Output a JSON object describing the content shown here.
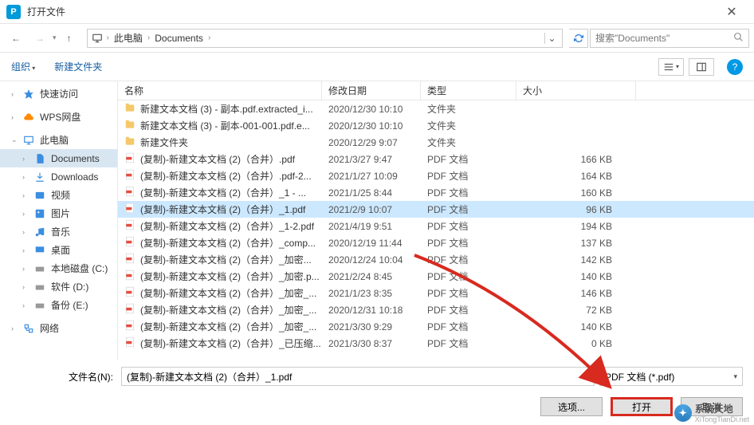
{
  "title": "打开文件",
  "nav": {
    "back": "←",
    "forward": "→",
    "up": "↑"
  },
  "breadcrumb": {
    "items": [
      "此电脑",
      "Documents"
    ],
    "search_placeholder": "搜索\"Documents\""
  },
  "toolbar": {
    "organize": "组织",
    "new_folder": "新建文件夹"
  },
  "sidebar": {
    "items": [
      {
        "label": "快速访问",
        "icon": "star",
        "color": "#3b8ee0",
        "chev": "›"
      },
      {
        "label": "WPS网盘",
        "icon": "cloud",
        "color": "#ff8a00",
        "chev": "›"
      },
      {
        "label": "此电脑",
        "icon": "pc",
        "color": "#3b8ee0",
        "chev": "⌄"
      },
      {
        "label": "Documents",
        "icon": "doc",
        "color": "#3b8ee0",
        "indent": true,
        "selected": true,
        "chev": "›"
      },
      {
        "label": "Downloads",
        "icon": "down",
        "color": "#3b8ee0",
        "indent": true,
        "chev": "›"
      },
      {
        "label": "视频",
        "icon": "video",
        "color": "#3b8ee0",
        "indent": true,
        "chev": "›"
      },
      {
        "label": "图片",
        "icon": "pic",
        "color": "#3b8ee0",
        "indent": true,
        "chev": "›"
      },
      {
        "label": "音乐",
        "icon": "music",
        "color": "#3b8ee0",
        "indent": true,
        "chev": "›"
      },
      {
        "label": "桌面",
        "icon": "desk",
        "color": "#3b8ee0",
        "indent": true,
        "chev": "›"
      },
      {
        "label": "本地磁盘 (C:)",
        "icon": "disk",
        "color": "#888",
        "indent": true,
        "chev": "›"
      },
      {
        "label": "软件 (D:)",
        "icon": "disk",
        "color": "#888",
        "indent": true,
        "chev": "›"
      },
      {
        "label": "备份 (E:)",
        "icon": "disk",
        "color": "#888",
        "indent": true,
        "chev": "›"
      },
      {
        "label": "网络",
        "icon": "net",
        "color": "#3b8ee0",
        "chev": "›"
      }
    ]
  },
  "columns": {
    "name": "名称",
    "date": "修改日期",
    "type": "类型",
    "size": "大小"
  },
  "files": [
    {
      "name": "新建文本文档 (3) - 副本.pdf.extracted_i...",
      "date": "2020/12/30 10:10",
      "type": "文件夹",
      "size": "",
      "kind": "folder"
    },
    {
      "name": "新建文本文档 (3) - 副本-001-001.pdf.e...",
      "date": "2020/12/30 10:10",
      "type": "文件夹",
      "size": "",
      "kind": "folder"
    },
    {
      "name": "新建文件夹",
      "date": "2020/12/29 9:07",
      "type": "文件夹",
      "size": "",
      "kind": "folder"
    },
    {
      "name": "(复制)-新建文本文档 (2)（合并）.pdf",
      "date": "2021/3/27 9:47",
      "type": "PDF 文档",
      "size": "166 KB",
      "kind": "pdf"
    },
    {
      "name": "(复制)-新建文本文档 (2)（合并）.pdf-2...",
      "date": "2021/1/27 10:09",
      "type": "PDF 文档",
      "size": "164 KB",
      "kind": "pdf"
    },
    {
      "name": "(复制)-新建文本文档 (2)（合并）_1 - ...",
      "date": "2021/1/25 8:44",
      "type": "PDF 文档",
      "size": "160 KB",
      "kind": "pdf"
    },
    {
      "name": "(复制)-新建文本文档 (2)（合并）_1.pdf",
      "date": "2021/2/9 10:07",
      "type": "PDF 文档",
      "size": "96 KB",
      "kind": "pdf",
      "selected": true
    },
    {
      "name": "(复制)-新建文本文档 (2)（合并）_1-2.pdf",
      "date": "2021/4/19 9:51",
      "type": "PDF 文档",
      "size": "194 KB",
      "kind": "pdf"
    },
    {
      "name": "(复制)-新建文本文档 (2)（合并）_comp...",
      "date": "2020/12/19 11:44",
      "type": "PDF 文档",
      "size": "137 KB",
      "kind": "pdf"
    },
    {
      "name": "(复制)-新建文本文档 (2)（合并）_加密...",
      "date": "2020/12/24 10:04",
      "type": "PDF 文档",
      "size": "142 KB",
      "kind": "pdf"
    },
    {
      "name": "(复制)-新建文本文档 (2)（合并）_加密.p...",
      "date": "2021/2/24 8:45",
      "type": "PDF 文档",
      "size": "140 KB",
      "kind": "pdf"
    },
    {
      "name": "(复制)-新建文本文档 (2)（合并）_加密_...",
      "date": "2021/1/23 8:35",
      "type": "PDF 文档",
      "size": "146 KB",
      "kind": "pdf"
    },
    {
      "name": "(复制)-新建文本文档 (2)（合并）_加密_...",
      "date": "2020/12/31 10:18",
      "type": "PDF 文档",
      "size": "72 KB",
      "kind": "pdf"
    },
    {
      "name": "(复制)-新建文本文档 (2)（合并）_加密_...",
      "date": "2021/3/30 9:29",
      "type": "PDF 文档",
      "size": "140 KB",
      "kind": "pdf"
    },
    {
      "name": "(复制)-新建文本文档 (2)（合并）_已压缩...",
      "date": "2021/3/30 8:37",
      "type": "PDF 文档",
      "size": "0 KB",
      "kind": "pdf"
    }
  ],
  "filename": {
    "label": "文件名(N):",
    "value": "(复制)-新建文本文档 (2)（合并）_1.pdf"
  },
  "filter": {
    "value": "PDF 文档 (*.pdf)"
  },
  "buttons": {
    "options": "选项...",
    "open": "打开",
    "cancel": "取消"
  },
  "watermark": {
    "brand": "系统天地",
    "url": "XiTongTianDi.net"
  },
  "icons": {
    "app": "P",
    "help": "?"
  }
}
